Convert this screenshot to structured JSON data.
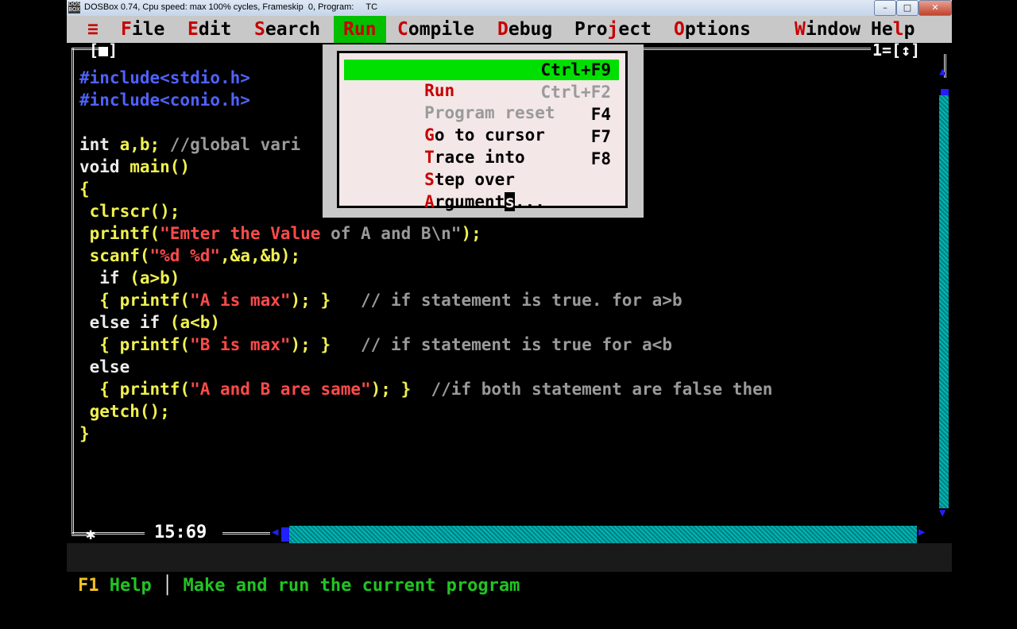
{
  "window": {
    "title": "DOSBox 0.74, Cpu speed: max 100% cycles, Frameskip  0, Program:     TC",
    "app_icon_text": "DOS BOX",
    "controls": [
      "–",
      "□",
      "✕"
    ]
  },
  "menubar": {
    "system": "≡",
    "items": [
      {
        "hotkey": "F",
        "rest": "ile"
      },
      {
        "hotkey": "E",
        "rest": "dit"
      },
      {
        "hotkey": "S",
        "rest": "earch"
      },
      {
        "hotkey": "R",
        "rest": "un"
      },
      {
        "hotkey": "C",
        "rest": "ompile"
      },
      {
        "hotkey": "D",
        "rest": "ebug"
      },
      {
        "pre": "Pro",
        "hotkey": "j",
        "rest": "ect"
      },
      {
        "hotkey": "O",
        "rest": "ptions"
      },
      {
        "hotkey": "W",
        "rest": "indow"
      },
      {
        "pre": "He",
        "hotkey": "l",
        "rest": "p"
      }
    ],
    "active_item": "Run"
  },
  "editor": {
    "close_box": "[■]",
    "window_number": "1=[↕]",
    "cursor_position": "15:69",
    "lines": [
      [
        {
          "t": "#include<stdio.h>",
          "c": "blue"
        }
      ],
      [
        {
          "t": "#include<conio.h>",
          "c": "blue"
        }
      ],
      [
        {
          "t": "",
          "c": "white"
        }
      ],
      [
        {
          "t": "int ",
          "c": "white"
        },
        {
          "t": "a,b; ",
          "c": "yellow"
        },
        {
          "t": "//global vari",
          "c": "gray"
        }
      ],
      [
        {
          "t": "void ",
          "c": "white"
        },
        {
          "t": "main()",
          "c": "yellow"
        }
      ],
      [
        {
          "t": "{",
          "c": "yellow"
        }
      ],
      [
        {
          "t": " clrscr();",
          "c": "yellow"
        }
      ],
      [
        {
          "t": " printf(",
          "c": "yellow"
        },
        {
          "t": "\"Emter the Value ",
          "c": "red"
        },
        {
          "t": "of A and B\\n\"",
          "c": "gray"
        },
        {
          "t": ");",
          "c": "yellow"
        }
      ],
      [
        {
          "t": " scanf(",
          "c": "yellow"
        },
        {
          "t": "\"%d %d\"",
          "c": "red"
        },
        {
          "t": ",&a,&b);",
          "c": "yellow"
        }
      ],
      [
        {
          "t": "  if ",
          "c": "white"
        },
        {
          "t": "(a>b)",
          "c": "yellow"
        }
      ],
      [
        {
          "t": "  { printf(",
          "c": "yellow"
        },
        {
          "t": "\"A is max\"",
          "c": "red"
        },
        {
          "t": "); }   ",
          "c": "yellow"
        },
        {
          "t": "// if statement is true. for a>b",
          "c": "gray"
        }
      ],
      [
        {
          "t": " else if ",
          "c": "white"
        },
        {
          "t": "(a<b)",
          "c": "yellow"
        }
      ],
      [
        {
          "t": "  { printf(",
          "c": "yellow"
        },
        {
          "t": "\"B is max\"",
          "c": "red"
        },
        {
          "t": "); }   ",
          "c": "yellow"
        },
        {
          "t": "// if statement is true for a<b",
          "c": "gray"
        }
      ],
      [
        {
          "t": " else",
          "c": "white"
        }
      ],
      [
        {
          "t": "  { printf(",
          "c": "yellow"
        },
        {
          "t": "\"A and B are same\"",
          "c": "red"
        },
        {
          "t": "); }  ",
          "c": "yellow"
        },
        {
          "t": "//if both statement are false then",
          "c": "gray"
        }
      ],
      [
        {
          "t": " getch();",
          "c": "yellow"
        }
      ],
      [
        {
          "t": "}",
          "c": "yellow"
        }
      ]
    ]
  },
  "run_menu": {
    "items": [
      {
        "hotkey": "R",
        "rest": "un",
        "shortcut": "Ctrl+F9",
        "state": "selected"
      },
      {
        "hotkey": "P",
        "rest": "rogram reset",
        "shortcut": "Ctrl+F2",
        "state": "disabled"
      },
      {
        "hotkey": "G",
        "rest": "o to cursor",
        "shortcut": "F4",
        "state": "normal"
      },
      {
        "hotkey": "T",
        "rest": "race into",
        "shortcut": "F7",
        "state": "normal"
      },
      {
        "hotkey": "S",
        "rest": "tep over",
        "shortcut": "F8",
        "state": "normal"
      },
      {
        "hotkey": "A",
        "rest": "rgument",
        "cursor": "s",
        "tail": "...",
        "shortcut": "",
        "state": "normal"
      }
    ]
  },
  "helpline": {
    "key": "F1",
    "label": " Help ",
    "separator": "│",
    "message": " Make and run the current program"
  },
  "colors": {
    "menubar_bg": "#c8c8c8",
    "hotkey": "#c80000",
    "highlight": "#00e000",
    "scrollbar": "#00a0a0"
  }
}
